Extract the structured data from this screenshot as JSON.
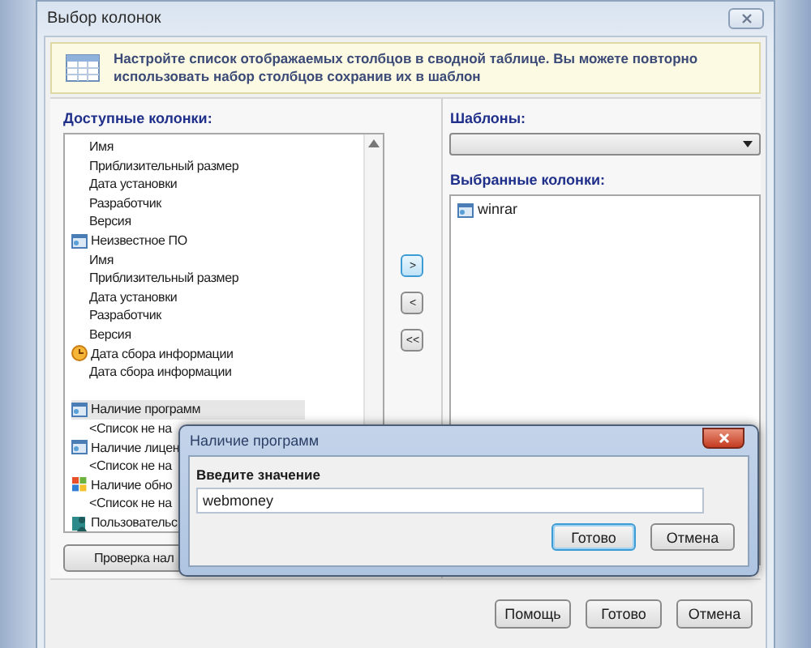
{
  "window": {
    "title": "Выбор колонок"
  },
  "banner": {
    "text": "Настройте список отображаемых столбцов в сводной таблице. Вы можете повторно использовать набор столбцов сохранив их в шаблон"
  },
  "available_columns": {
    "label": "Доступные колонки:",
    "items": [
      {
        "kind": "field",
        "label": "Имя",
        "selected": false
      },
      {
        "kind": "field",
        "label": "Приблизительный размер",
        "selected": false
      },
      {
        "kind": "field",
        "label": "Дата установки",
        "selected": false
      },
      {
        "kind": "field",
        "label": "Разработчик",
        "selected": false
      },
      {
        "kind": "field",
        "label": "Версия",
        "selected": false
      },
      {
        "kind": "app-group",
        "label": "Неизвестное ПО",
        "selected": false,
        "children": [
          {
            "label": "Имя",
            "selected": false
          },
          {
            "label": "Приблизительный размер",
            "selected": false
          },
          {
            "label": "Дата установки",
            "selected": false
          },
          {
            "label": "Разработчик",
            "selected": false
          },
          {
            "label": "Версия",
            "selected": false
          }
        ]
      },
      {
        "kind": "date-group",
        "label": "Дата сбора информации",
        "selected": false,
        "children": [
          {
            "label": "Дата сбора информации",
            "selected": false
          }
        ]
      },
      {
        "kind": "gap"
      },
      {
        "kind": "app-group",
        "label": "Наличие программ",
        "selected": true,
        "children": [
          {
            "label": "<Список не на",
            "selected": false
          }
        ]
      },
      {
        "kind": "app-group",
        "label": "Наличие лицен",
        "selected": false,
        "children": [
          {
            "label": "<Список не на",
            "selected": false
          }
        ]
      },
      {
        "kind": "update-group",
        "label": "Наличие обно",
        "selected": false,
        "children": [
          {
            "label": "<Список не на",
            "selected": false
          }
        ]
      },
      {
        "kind": "user-group",
        "label": "Пользовательс",
        "selected": false
      }
    ],
    "button": "Проверка нал"
  },
  "transfer_buttons": [
    {
      "label": ">",
      "focused": true
    },
    {
      "label": "<",
      "focused": false
    },
    {
      "label": "<<",
      "focused": false
    }
  ],
  "templates": {
    "label": "Шаблоны:"
  },
  "selected_columns": {
    "label": "Выбранные колонки:",
    "items": [
      {
        "kind": "app-group",
        "label": "winrar"
      }
    ]
  },
  "footer_buttons": [
    "Помощь",
    "Готово",
    "Отмена"
  ],
  "dialog": {
    "title": "Наличие программ",
    "label": "Введите значение",
    "value": "webmoney",
    "buttons": [
      {
        "label": "Готово",
        "focused": true
      },
      {
        "label": "Отмена",
        "focused": false
      }
    ]
  }
}
